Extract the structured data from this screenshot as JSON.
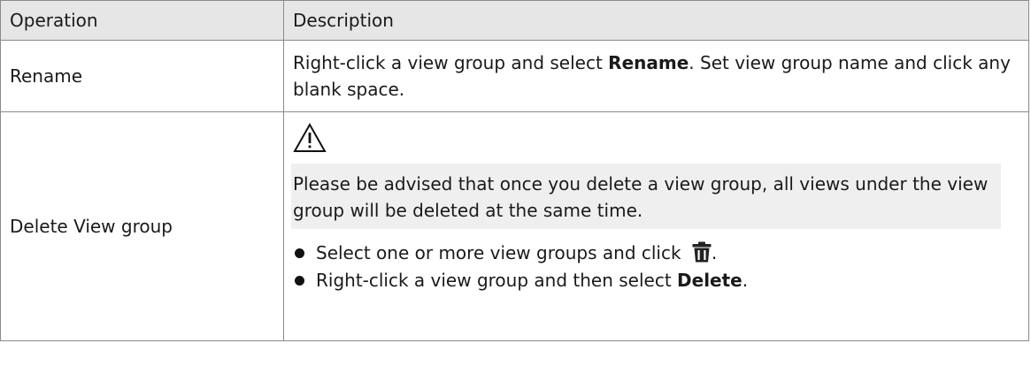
{
  "table": {
    "headers": [
      "Operation",
      "Description"
    ],
    "rows": [
      {
        "operation": "Rename",
        "desc_before": "Right-click a view group and select ",
        "desc_bold": "Rename",
        "desc_after": ". Set view group name and click any blank space."
      },
      {
        "operation": "Delete View group",
        "warning_icon": "warning-triangle-icon",
        "notice": "Please be advised that once you delete a view group, all views under the view group will be deleted at the same time.",
        "steps": [
          {
            "text_before": "Select one or more view groups and click ",
            "icon": "trash-icon",
            "text_after": "."
          },
          {
            "text_before": "Right-click a view group and then select ",
            "bold": "Delete",
            "text_after": "."
          }
        ]
      }
    ]
  },
  "colors": {
    "header_bg": "#e6e6e6",
    "notice_bg": "#efefef",
    "border": "#8a8a8a"
  }
}
